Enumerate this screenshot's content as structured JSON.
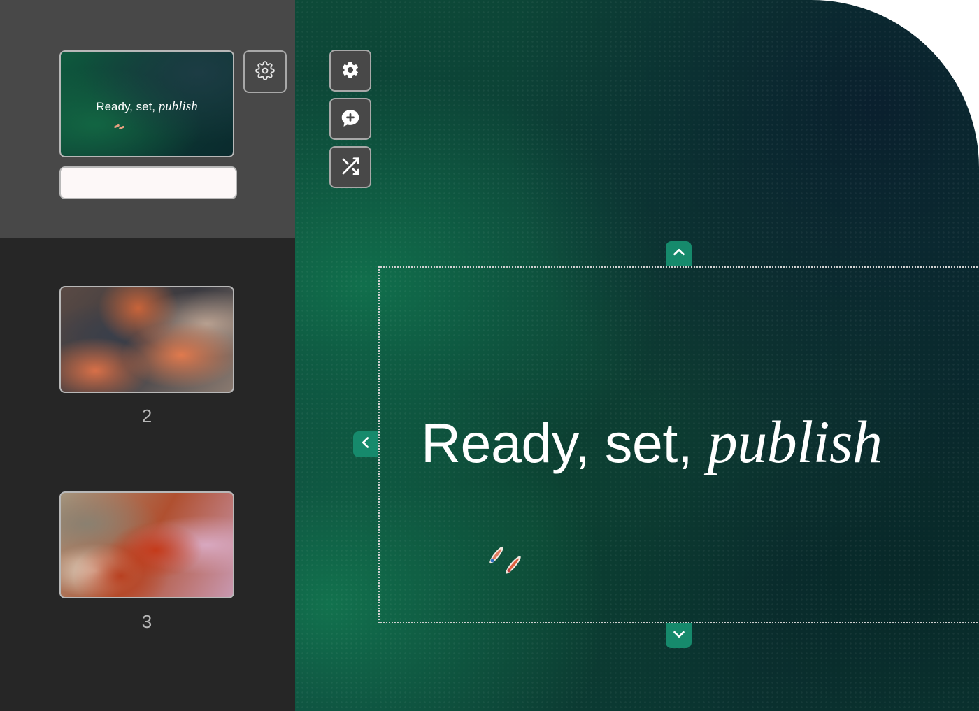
{
  "sidebar": {
    "slides": [
      {
        "title_regular": "Ready, set, ",
        "title_italic": "publish",
        "selected": true,
        "slide_name_value": ""
      },
      {
        "number": "2"
      },
      {
        "number": "3"
      }
    ],
    "settings_icon": "gear-outline-icon"
  },
  "toolbar": {
    "items": [
      {
        "icon": "gear-icon"
      },
      {
        "icon": "comment-add-icon"
      },
      {
        "icon": "shuffle-icon"
      }
    ]
  },
  "canvas": {
    "heading_regular": "Ready, set, ",
    "heading_italic": "publish",
    "handle_up_icon": "chevron-up-icon",
    "handle_down_icon": "chevron-down-icon",
    "handle_left_icon": "chevron-left-icon"
  },
  "colors": {
    "accent": "#168a6c",
    "sidebar_bg": "#262626",
    "sidebar_active_bg": "#484848",
    "border": "#b8b8b8"
  }
}
